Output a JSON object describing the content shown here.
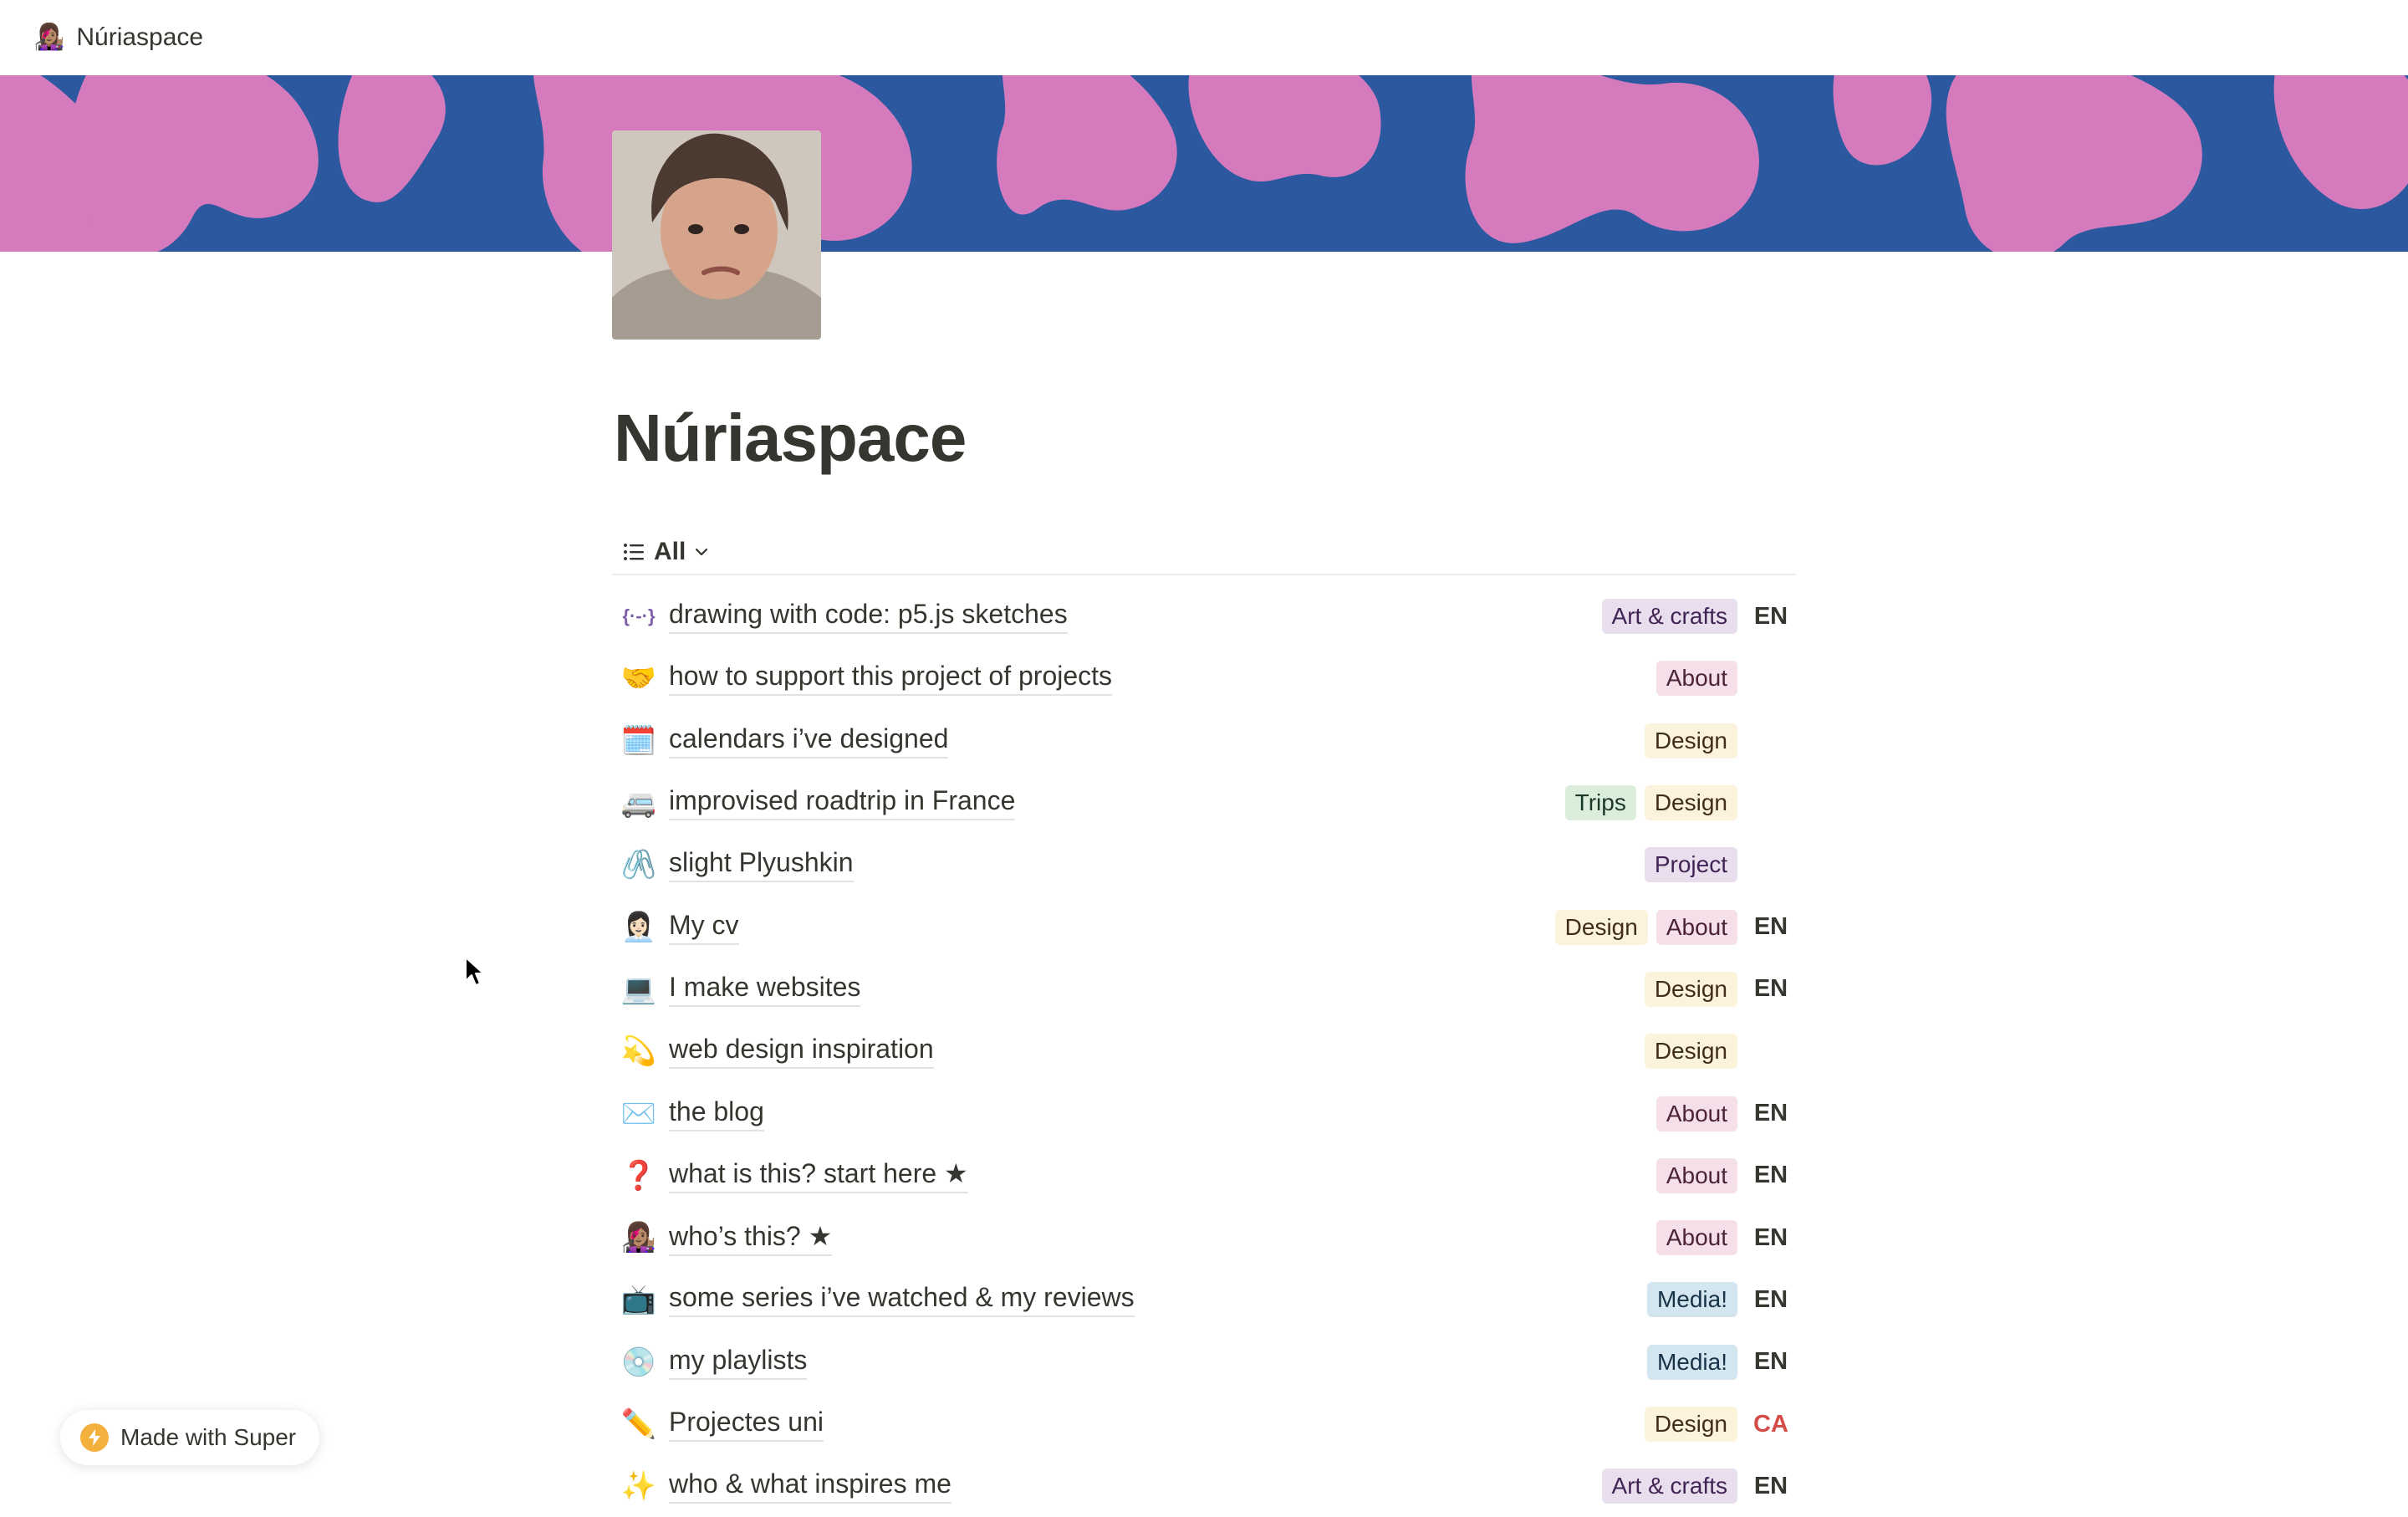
{
  "topbar": {
    "site_icon": "👩🏽‍🎤",
    "site_title": "Núriaspace"
  },
  "cover": {
    "background_color": "#2c58a0",
    "blob_color": "#d57bbd"
  },
  "avatar": {
    "icon": "profile-photo"
  },
  "page": {
    "title": "Núriaspace"
  },
  "view": {
    "label": "All",
    "icon": "list-icon"
  },
  "items": [
    {
      "emoji": "{·-·}",
      "title": "drawing with code: p5.js sketches",
      "tags": [
        {
          "label": "Art & crafts",
          "kind": "art"
        }
      ],
      "lang": "EN"
    },
    {
      "emoji": "🤝",
      "title": "how to support this project of projects",
      "tags": [
        {
          "label": "About",
          "kind": "about"
        }
      ],
      "lang": ""
    },
    {
      "emoji": "🗓️",
      "title": "calendars i’ve designed",
      "tags": [
        {
          "label": "Design",
          "kind": "design"
        }
      ],
      "lang": ""
    },
    {
      "emoji": "🚐",
      "title": "improvised roadtrip in France",
      "tags": [
        {
          "label": "Trips",
          "kind": "trips"
        },
        {
          "label": "Design",
          "kind": "design"
        }
      ],
      "lang": ""
    },
    {
      "emoji": "🖇️",
      "title": "slight Plyushkin",
      "tags": [
        {
          "label": "Project",
          "kind": "project"
        }
      ],
      "lang": ""
    },
    {
      "emoji": "👩🏻‍💼",
      "title": "My cv",
      "tags": [
        {
          "label": "Design",
          "kind": "design"
        },
        {
          "label": "About",
          "kind": "about"
        }
      ],
      "lang": "EN"
    },
    {
      "emoji": "💻",
      "title": "I make websites",
      "tags": [
        {
          "label": "Design",
          "kind": "design"
        }
      ],
      "lang": "EN"
    },
    {
      "emoji": "💫",
      "title": "web design inspiration",
      "tags": [
        {
          "label": "Design",
          "kind": "design"
        }
      ],
      "lang": ""
    },
    {
      "emoji": "✉️",
      "title": "the blog",
      "tags": [
        {
          "label": "About",
          "kind": "about"
        }
      ],
      "lang": "EN"
    },
    {
      "emoji": "❓",
      "title": "what is this? start here ★",
      "tags": [
        {
          "label": "About",
          "kind": "about"
        }
      ],
      "lang": "EN"
    },
    {
      "emoji": "👩🏽‍🎤",
      "title": "who’s this? ★",
      "tags": [
        {
          "label": "About",
          "kind": "about"
        }
      ],
      "lang": "EN"
    },
    {
      "emoji": "📺",
      "title": "some series i’ve watched & my reviews",
      "tags": [
        {
          "label": "Media!",
          "kind": "media"
        }
      ],
      "lang": "EN"
    },
    {
      "emoji": "💿",
      "title": "my playlists",
      "tags": [
        {
          "label": "Media!",
          "kind": "media"
        }
      ],
      "lang": "EN"
    },
    {
      "emoji": "✏️",
      "title": "Projectes uni",
      "tags": [
        {
          "label": "Design",
          "kind": "design"
        }
      ],
      "lang": "CA"
    },
    {
      "emoji": "✨",
      "title": "who & what inspires me",
      "tags": [
        {
          "label": "Art & crafts",
          "kind": "art"
        }
      ],
      "lang": "EN"
    }
  ],
  "badge": {
    "label": "Made with Super",
    "icon": "bolt-icon"
  }
}
